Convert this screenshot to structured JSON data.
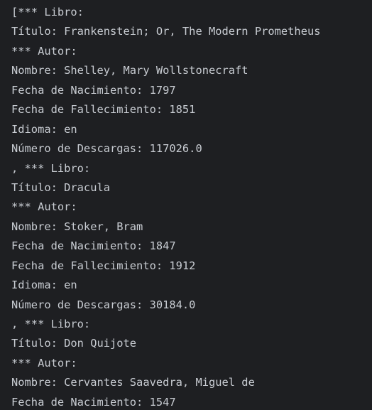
{
  "console": {
    "lines": [
      "[*** Libro:",
      "Título: Frankenstein; Or, The Modern Prometheus",
      "*** Autor:",
      "Nombre: Shelley, Mary Wollstonecraft",
      "Fecha de Nacimiento: 1797",
      "Fecha de Fallecimiento: 1851",
      "Idioma: en",
      "Número de Descargas: 117026.0",
      ", *** Libro:",
      "Título: Dracula",
      "*** Autor:",
      "Nombre: Stoker, Bram",
      "Fecha de Nacimiento: 1847",
      "Fecha de Fallecimiento: 1912",
      "Idioma: en",
      "Número de Descargas: 30184.0",
      ", *** Libro:",
      "Título: Don Quijote",
      "*** Autor:",
      "Nombre: Cervantes Saavedra, Miguel de",
      "Fecha de Nacimiento: 1547"
    ]
  }
}
